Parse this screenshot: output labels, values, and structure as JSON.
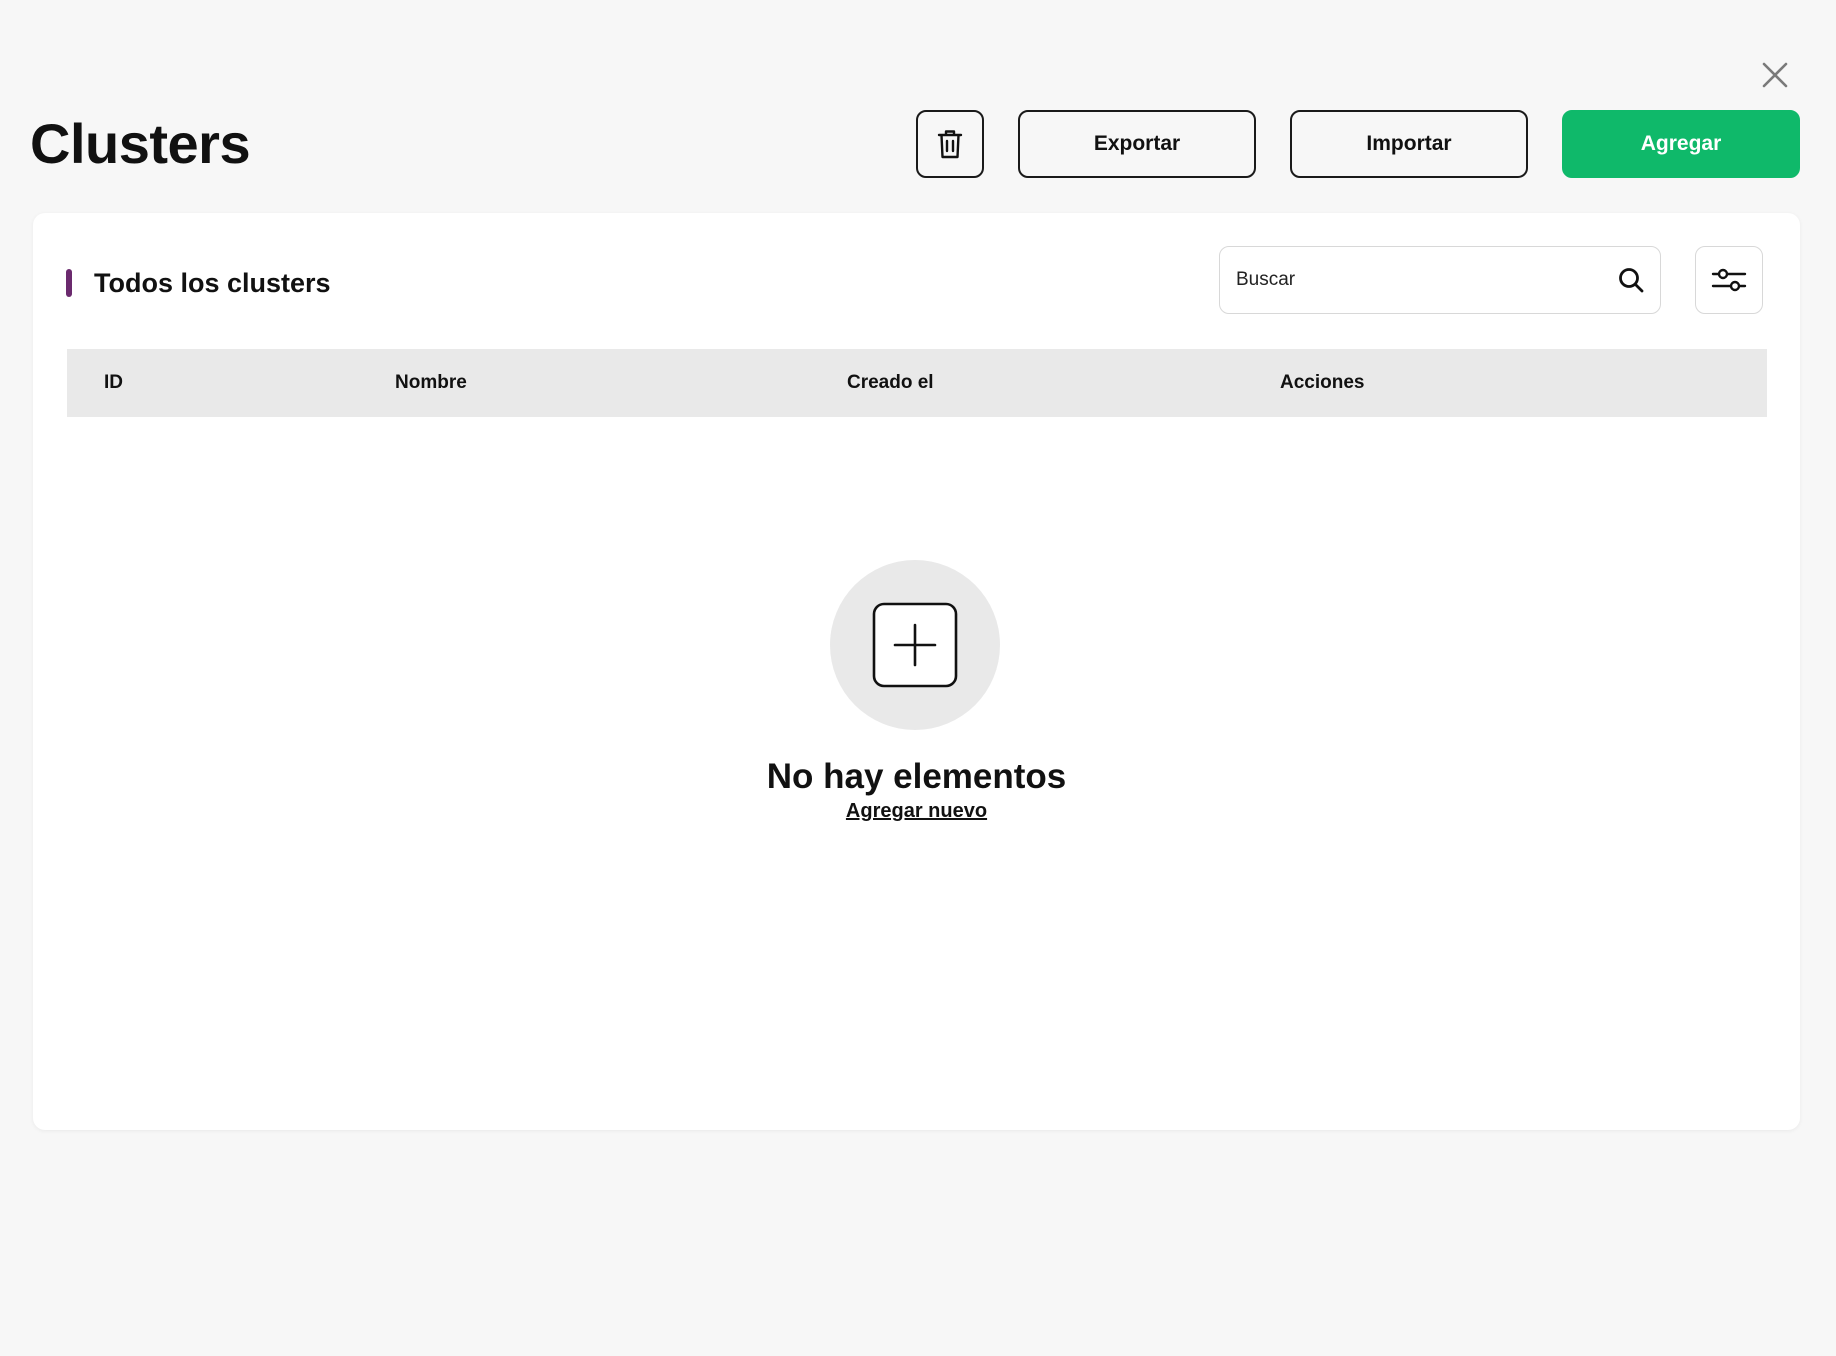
{
  "header": {
    "title": "Clusters",
    "close_icon": "close-icon"
  },
  "toolbar": {
    "delete_icon": "trash-icon",
    "export_label": "Exportar",
    "import_label": "Importar",
    "add_label": "Agregar"
  },
  "card": {
    "title": "Todos los clusters",
    "search": {
      "placeholder": "Buscar",
      "value": ""
    },
    "filter_icon": "sliders-icon"
  },
  "table": {
    "columns": [
      "ID",
      "Nombre",
      "Creado el",
      "Acciones"
    ],
    "rows": []
  },
  "empty_state": {
    "icon": "add-square-icon",
    "title": "No hay elementos",
    "link_label": "Agregar nuevo"
  },
  "colors": {
    "primary": "#0fb96a",
    "accent": "#6b2a6e",
    "background": "#f7f7f7",
    "table_header": "#e9e9e9"
  }
}
